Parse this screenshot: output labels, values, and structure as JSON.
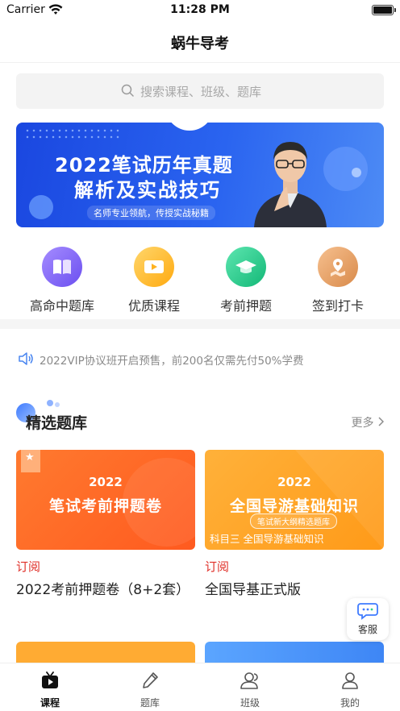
{
  "status_bar": {
    "carrier": "Carrier",
    "time": "11:28 PM"
  },
  "nav": {
    "title": "蜗牛导考"
  },
  "search": {
    "placeholder": "搜索课程、班级、题库"
  },
  "banner": {
    "line1": "2022笔试历年真题",
    "line2": "解析及实战技巧",
    "line3": "名师专业领航，传授实战秘籍"
  },
  "categories": [
    {
      "label": "高命中题库",
      "icon": "book-icon",
      "color": "#8b6cf7"
    },
    {
      "label": "优质课程",
      "icon": "video-icon",
      "color": "#ffbf2a"
    },
    {
      "label": "考前押题",
      "icon": "graduation-cap-icon",
      "color": "#2ccf8f"
    },
    {
      "label": "签到打卡",
      "icon": "map-pin-icon",
      "color": "#e8a56a"
    }
  ],
  "notice": {
    "text": "2022VIP协议班开启预售，前200名仅需先付50%学费"
  },
  "section": {
    "title": "精选题库",
    "more": "更多"
  },
  "cards": [
    {
      "cover_year": "2022",
      "cover_title": "笔试考前押题卷",
      "sub": "订阅",
      "title": "2022考前押题卷（8+2套）"
    },
    {
      "cover_year": "2022",
      "cover_title": "全国导游基础知识",
      "cover_pill": "笔试新大纲精选题库",
      "cover_subject": "科目三 全国导游基础知识",
      "sub": "订阅",
      "title": "全国导基正式版"
    }
  ],
  "service": {
    "label": "客服"
  },
  "tabs": [
    {
      "label": "课程",
      "icon": "tv-icon",
      "active": true
    },
    {
      "label": "题库",
      "icon": "pencil-icon",
      "active": false
    },
    {
      "label": "班级",
      "icon": "group-icon",
      "active": false
    },
    {
      "label": "我的",
      "icon": "user-icon",
      "active": false
    }
  ],
  "colors": {
    "accent_red": "#e0312a",
    "banner_blue": "#1a47e0",
    "muted_text": "#8a8a8a"
  }
}
